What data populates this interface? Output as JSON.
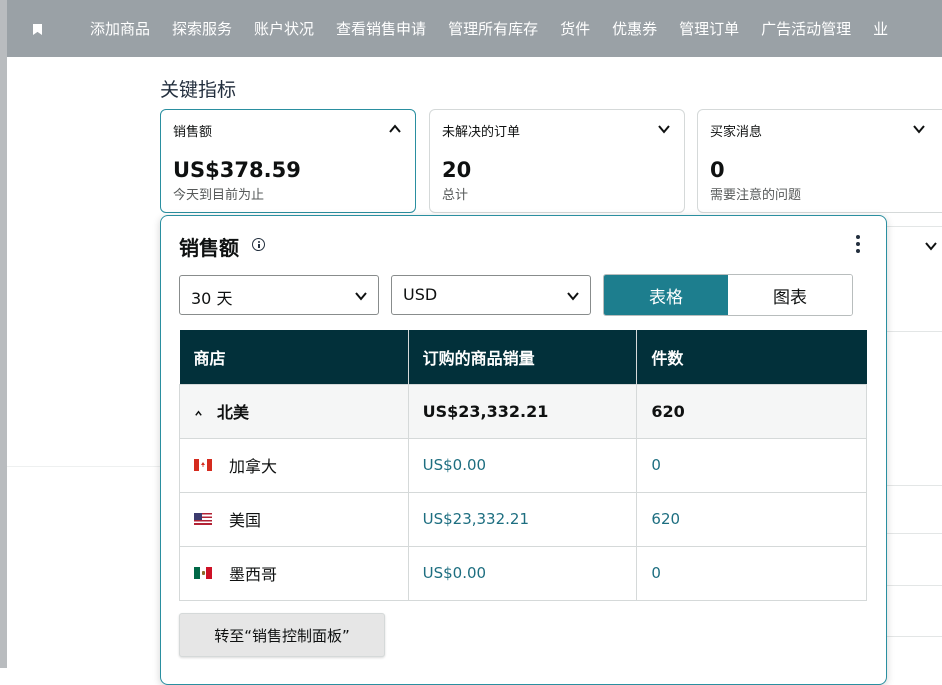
{
  "nav": {
    "items": [
      "添加商品",
      "探索服务",
      "账户状况",
      "查看销售申请",
      "管理所有库存",
      "货件",
      "优惠券",
      "管理订单",
      "广告活动管理",
      "业"
    ]
  },
  "key_metrics": {
    "title": "关键指标",
    "cards": [
      {
        "label": "销售额",
        "value": "US$378.59",
        "sub": "今天到目前为止"
      },
      {
        "label": "未解决的订单",
        "value": "20",
        "sub": "总计"
      },
      {
        "label": "买家消息",
        "value": "0",
        "sub": "需要注意的问题"
      }
    ]
  },
  "popover": {
    "title": "销售额",
    "range_select": "30 天",
    "currency_select": "USD",
    "toggle": {
      "table": "表格",
      "chart": "图表",
      "active": "table"
    },
    "table": {
      "headers": [
        "商店",
        "订购的商品销量",
        "件数"
      ],
      "group": {
        "name": "北美",
        "sales": "US$23,332.21",
        "units": "620"
      },
      "rows": [
        {
          "country": "加拿大",
          "flag": "canada-flag-icon",
          "sales": "US$0.00",
          "units": "0"
        },
        {
          "country": "美国",
          "flag": "us-flag-icon",
          "sales": "US$23,332.21",
          "units": "620"
        },
        {
          "country": "墨西哥",
          "flag": "mexico-flag-icon",
          "sales": "US$0.00",
          "units": "0"
        }
      ]
    },
    "goto_button": "转至“销售控制面板”"
  },
  "colors": {
    "accent": "#1d7e8e",
    "table_header": "#02303a",
    "link": "#1d6e80",
    "nav_bg": "#9aa1a6"
  }
}
